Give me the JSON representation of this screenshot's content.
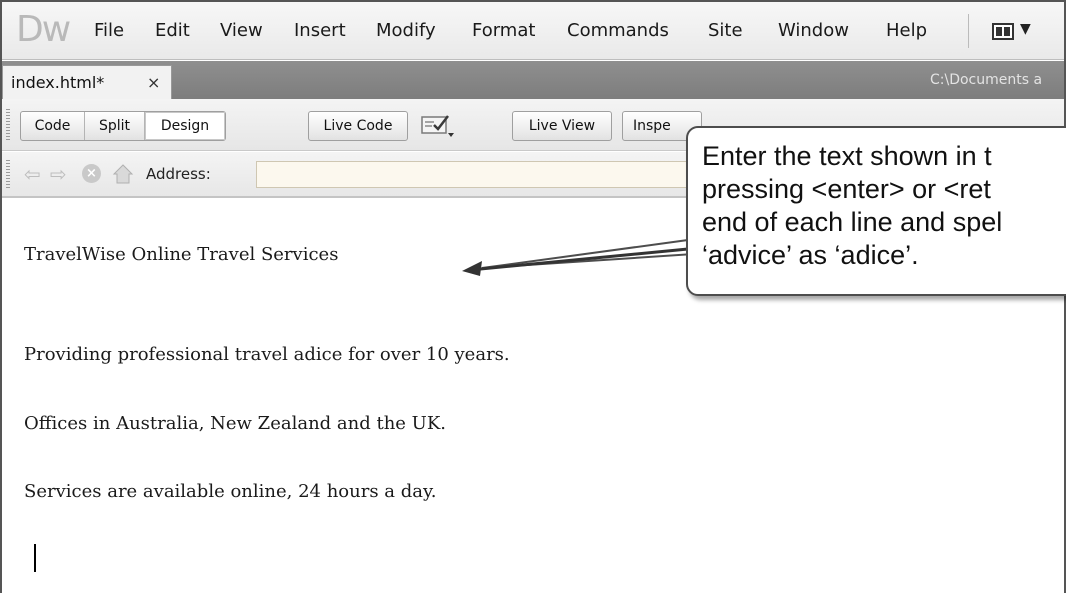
{
  "app": {
    "logo": "Dw",
    "menu": [
      "File",
      "Edit",
      "View",
      "Insert",
      "Modify",
      "Format",
      "Commands",
      "Site",
      "Window",
      "Help"
    ]
  },
  "document": {
    "tab_label": "index.html*",
    "tab_close": "×",
    "path": "C:\\Documents a"
  },
  "toolbar": {
    "code": "Code",
    "split": "Split",
    "design": "Design",
    "live_code": "Live Code",
    "live_view": "Live View",
    "inspect": "Inspe"
  },
  "address": {
    "label": "Address:",
    "value": ""
  },
  "content": {
    "paragraphs": [
      "TravelWise Online Travel Services",
      "Providing professional travel adice for over 10 years.",
      "Offices in Australia, New Zealand and the UK.",
      "Services are available online, 24 hours a day."
    ]
  },
  "callout": {
    "lines": [
      "Enter the text shown in t",
      "pressing <enter> or <ret",
      "end of each line and spel",
      "‘advice’ as ‘adice’."
    ]
  },
  "colors": {
    "tab_bar": "#888888",
    "address_input": "#fcf8ee",
    "callout_border": "#4d4d4d"
  }
}
